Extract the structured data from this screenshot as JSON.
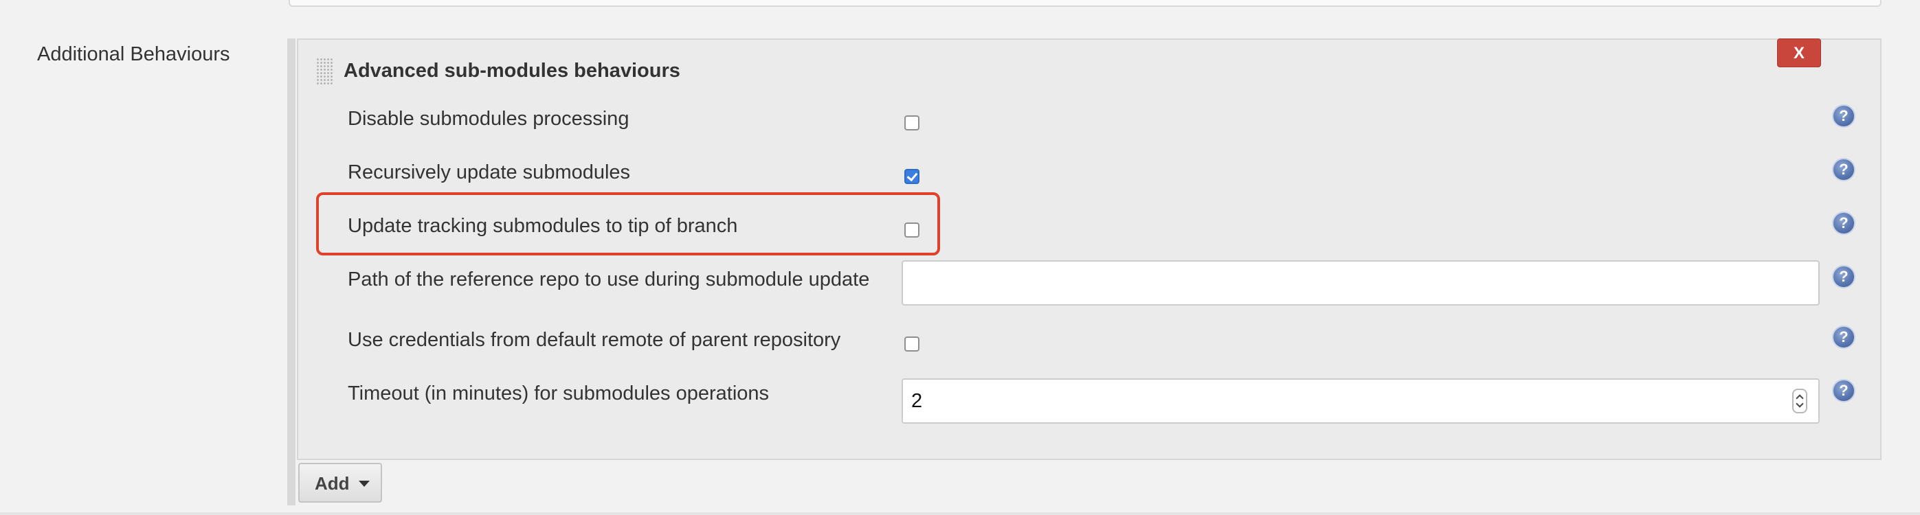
{
  "section": {
    "label": "Additional Behaviours"
  },
  "behaviour": {
    "title": "Advanced sub-modules behaviours",
    "delete_label": "X",
    "rows": [
      {
        "label": "Disable submodules processing",
        "control": "checkbox",
        "checked": false
      },
      {
        "label": "Recursively update submodules",
        "control": "checkbox",
        "checked": true
      },
      {
        "label": "Update tracking submodules to tip of branch",
        "control": "checkbox",
        "checked": false,
        "highlighted": true
      },
      {
        "label": "Path of the reference repo to use during submodule update",
        "control": "text",
        "value": ""
      },
      {
        "label": "Use credentials from default remote of parent repository",
        "control": "checkbox",
        "checked": false
      },
      {
        "label": "Timeout (in minutes) for submodules operations",
        "control": "number",
        "value": "2"
      }
    ],
    "help_icon": "?",
    "help_icon_name": "help-icon"
  },
  "add_button": {
    "label": "Add",
    "icon": "caret-down-icon"
  },
  "colors": {
    "highlight": "#e0412b",
    "delete_button": "#c9463d",
    "checkbox_checked": "#3b7ee0",
    "help_icon": "#5a77b2"
  }
}
